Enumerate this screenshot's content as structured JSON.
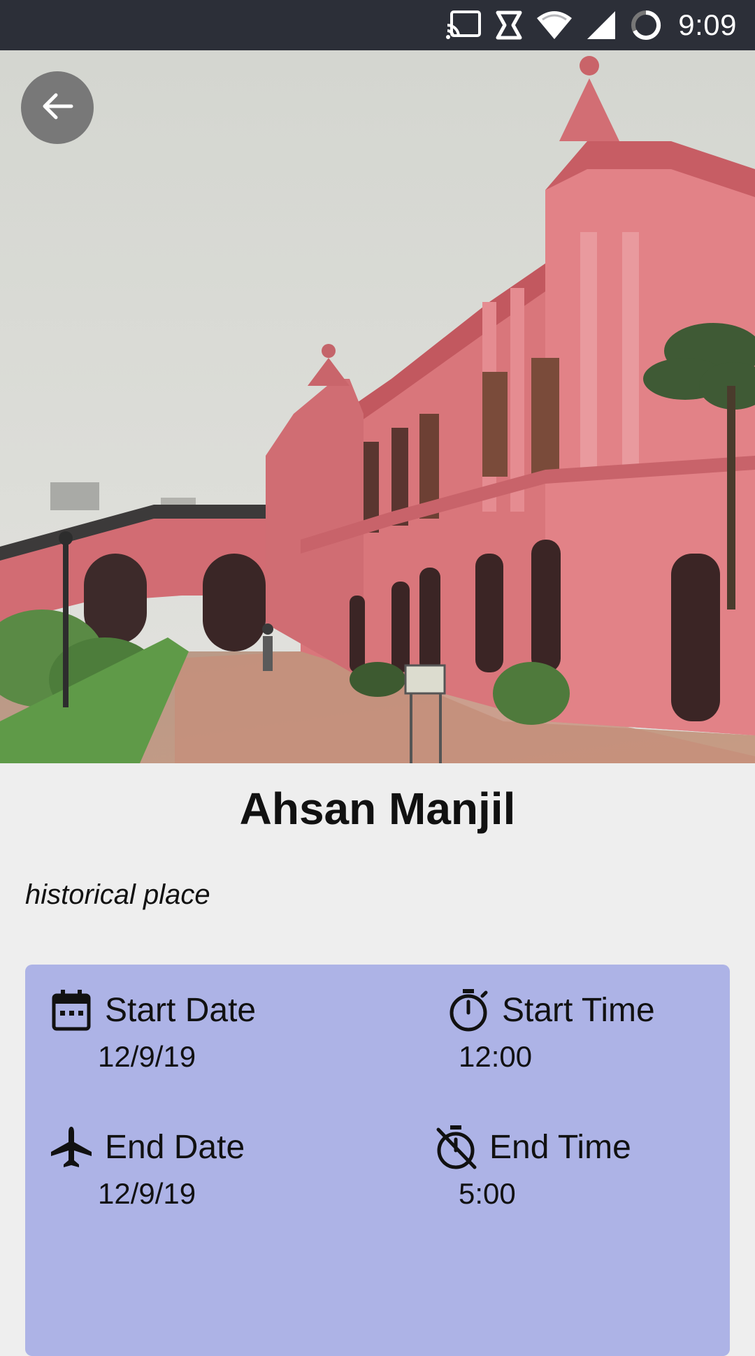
{
  "status_bar": {
    "time": "9:09",
    "icons": [
      "cast-icon",
      "sync-icon",
      "wifi-icon",
      "cell-signal-icon",
      "loading-icon"
    ]
  },
  "header": {
    "back_icon": "arrow-back-icon"
  },
  "place": {
    "name": "Ahsan Manjil",
    "category": "historical place"
  },
  "schedule": {
    "start_date": {
      "label": "Start Date",
      "value": "12/9/19",
      "icon": "calendar-icon"
    },
    "start_time": {
      "label": "Start Time",
      "value": "12:00",
      "icon": "timer-icon"
    },
    "end_date": {
      "label": "End Date",
      "value": "12/9/19",
      "icon": "airplane-icon"
    },
    "end_time": {
      "label": "End Time",
      "value": "5:00",
      "icon": "timer-off-icon"
    }
  },
  "colors": {
    "status_bar": "#2c2f38",
    "page_background": "#eeeeee",
    "card_background": "#adb3e6",
    "building": "#d9767b"
  }
}
